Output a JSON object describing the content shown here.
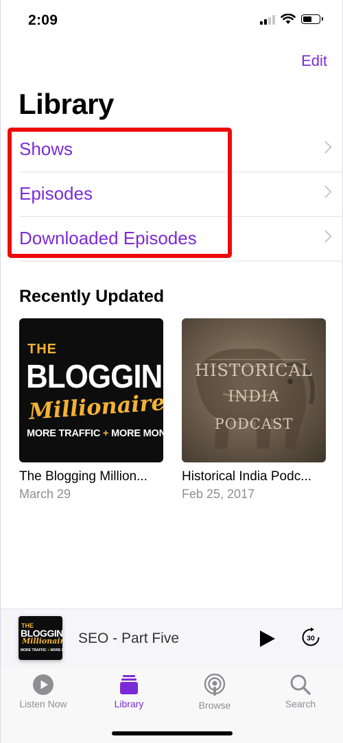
{
  "status_bar": {
    "time": "2:09"
  },
  "header": {
    "edit_label": "Edit",
    "title": "Library"
  },
  "menu": {
    "items": [
      {
        "label": "Shows"
      },
      {
        "label": "Episodes"
      },
      {
        "label": "Downloaded Episodes"
      }
    ]
  },
  "recently_updated": {
    "title": "Recently Updated",
    "shows": [
      {
        "name": "The Blogging Million...",
        "date": "March 29",
        "artwork": {
          "line1": "THE",
          "line2": "BLOGGING",
          "line3": "Millionaire",
          "tagline_a": "MORE TRAFFIC",
          "tagline_plus": "+",
          "tagline_b": "MORE MONEY"
        }
      },
      {
        "name": "Historical India Podc...",
        "date": "Feb 25, 2017",
        "artwork": {
          "line1": "HISTORICAL",
          "line2": "INDIA",
          "line3": "PODCAST"
        }
      }
    ]
  },
  "mini_player": {
    "episode": "SEO - Part Five",
    "skip_seconds": "30"
  },
  "tabs": [
    {
      "label": "Listen Now",
      "icon": "play-circle-icon",
      "active": false
    },
    {
      "label": "Library",
      "icon": "library-stack-icon",
      "active": true
    },
    {
      "label": "Browse",
      "icon": "podcasts-icon",
      "active": false
    },
    {
      "label": "Search",
      "icon": "magnifier-icon",
      "active": false
    }
  ],
  "colors": {
    "accent": "#7b2bd6",
    "highlight": "#ee0a0a",
    "secondary_text": "#8e8e93"
  }
}
